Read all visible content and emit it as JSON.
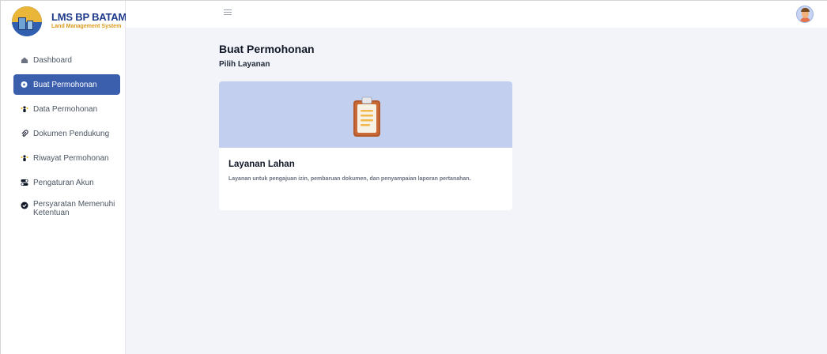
{
  "brand": {
    "title": "LMS BP BATAM",
    "subtitle": "Land Management System"
  },
  "sidebar": {
    "items": [
      {
        "label": "Dashboard",
        "icon": "home-icon",
        "active": false
      },
      {
        "label": "Buat Permohonan",
        "icon": "new-request-icon",
        "active": true
      },
      {
        "label": "Data Permohonan",
        "icon": "users-icon",
        "active": false
      },
      {
        "label": "Dokumen Pendukung",
        "icon": "paperclip-icon",
        "active": false
      },
      {
        "label": "Riwayat Permohonan",
        "icon": "users-icon",
        "active": false
      },
      {
        "label": "Pengaturan Akun",
        "icon": "toggle-icon",
        "active": false
      },
      {
        "label": "Persyaratan Memenuhi Ketentuan",
        "icon": "check-circle-icon",
        "active": false
      }
    ]
  },
  "header": {
    "menu_icon": "hamburger-icon",
    "avatar_icon": "user-avatar"
  },
  "main": {
    "title": "Buat Permohonan",
    "subtitle": "Pilih Layanan",
    "cards": [
      {
        "title": "Layanan Lahan",
        "description": "Layanan untuk pengajuan izin, pembaruan dokumen, dan penyampaian laporan pertanahan.",
        "icon": "clipboard-icon"
      }
    ]
  },
  "colors": {
    "accent": "#3b5fad",
    "banner": "#c2cfee",
    "background": "#f3f4f9",
    "brand_title": "#1e3a8a",
    "brand_subtitle": "#d99a1a"
  }
}
